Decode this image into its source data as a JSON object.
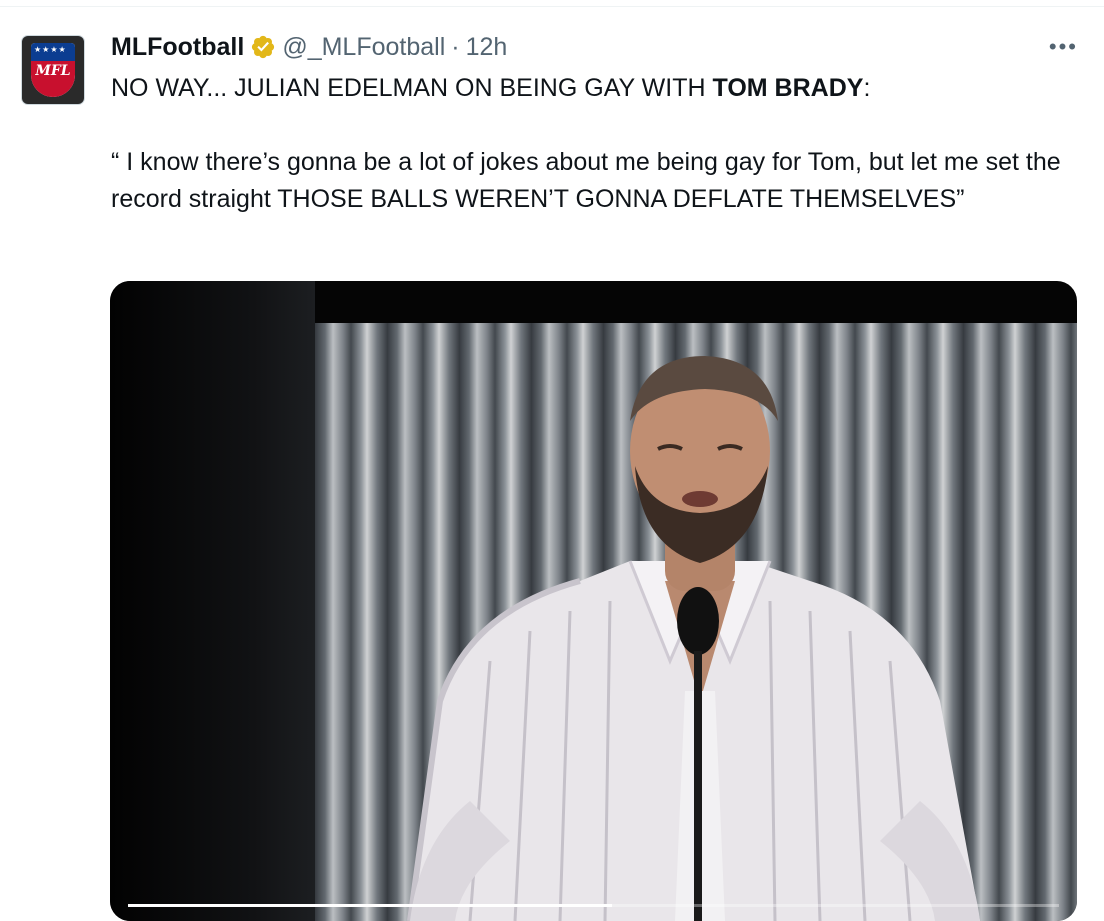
{
  "tweet": {
    "display_name": "MLFootball",
    "handle": "@_MLFootball",
    "separator": "·",
    "time": "12h",
    "avatar_text": "MFL",
    "more_label": "•••",
    "text_part1": "NO WAY... JULIAN EDELMAN ON BEING GAY WITH ",
    "text_bold": "TOM BRADY",
    "text_part2": ":",
    "quote": "“ I know there’s gonna be a lot of jokes about me being gay for Tom, but let me set the record straight THOSE BALLS WEREN’T GONNA DEFLATE THEMSELVES”"
  },
  "media": {
    "type": "video",
    "progress": 0.52
  },
  "colors": {
    "text": "#0f1419",
    "secondary": "#536471",
    "verified_gold": "#e2b719"
  },
  "icons": [
    "avatar-logo",
    "verified-badge-icon",
    "more-options-icon"
  ]
}
